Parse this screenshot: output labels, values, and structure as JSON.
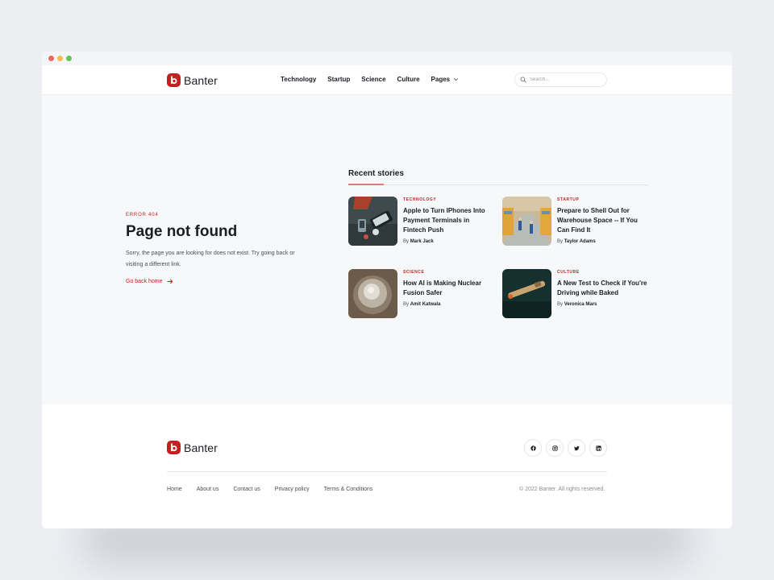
{
  "brand": {
    "name": "Banter",
    "color": "#c4201f"
  },
  "nav": {
    "items": [
      "Technology",
      "Startup",
      "Science",
      "Culture"
    ],
    "dropdown": "Pages"
  },
  "search": {
    "placeholder": "Search..."
  },
  "error": {
    "code": "ERROR 404",
    "title": "Page not found",
    "description": "Sorry, the page you are looking for does not exist. Try going back or visiting a different link.",
    "link": "Go back home"
  },
  "recent": {
    "title": "Recent stories",
    "stories": [
      {
        "category": "TECHNOLOGY",
        "title": "Apple to Turn IPhones Into Payment Terminals in Fintech Push",
        "by": "By",
        "author": "Mark Jack"
      },
      {
        "category": "STARTUP",
        "title": "Prepare to Shell Out for Warehouse Space -- If You Can Find It",
        "by": "By",
        "author": "Taylor Adams"
      },
      {
        "category": "SCIENCE",
        "title": "How AI is Making Nuclear Fusion Safer",
        "by": "By",
        "author": "Amit Katwala"
      },
      {
        "category": "CULTURE",
        "title": "A New Test to Check if You're Driving while Baked",
        "by": "By",
        "author": "Veronica Mars"
      }
    ]
  },
  "footer": {
    "links": [
      "Home",
      "About us",
      "Contact us",
      "Privacy policy",
      "Terms & Conditions"
    ],
    "copyright": "© 2022 Banter. All rights reserved.",
    "socials": [
      "facebook-icon",
      "instagram-icon",
      "twitter-icon",
      "linkedin-icon"
    ]
  }
}
